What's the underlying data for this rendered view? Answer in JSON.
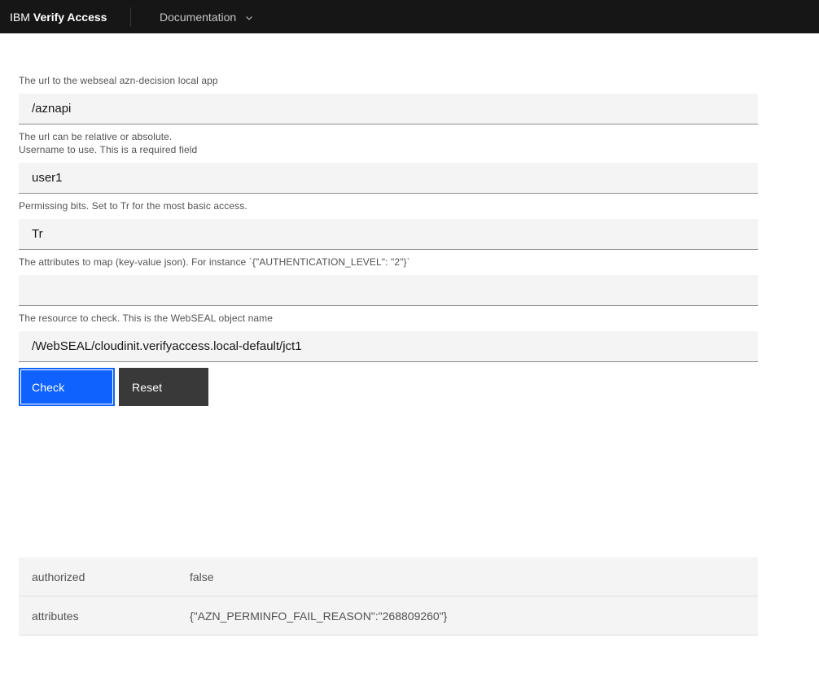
{
  "header": {
    "brand_prefix": "IBM",
    "brand_name": "Verify Access",
    "menu": {
      "documentation_label": "Documentation"
    }
  },
  "form": {
    "fields": [
      {
        "label": "The url to the webseal azn-decision local app",
        "value": "/aznapi",
        "helper": "The url can be relative or absolute."
      },
      {
        "label": "Username to use. This is a required field",
        "value": "user1"
      },
      {
        "label": "Permissing bits. Set to Tr for the most basic access.",
        "value": "Tr"
      },
      {
        "label": "The attributes to map (key-value json). For instance `{\"AUTHENTICATION_LEVEL\": \"2\"}`",
        "value": ""
      },
      {
        "label": "The resource to check. This is the WebSEAL object name",
        "value": "/WebSEAL/cloudinit.verifyaccess.local-default/jct1"
      }
    ],
    "buttons": {
      "check_label": "Check",
      "reset_label": "Reset"
    }
  },
  "results": {
    "rows": [
      {
        "key": "authorized",
        "value": "false"
      },
      {
        "key": "attributes",
        "value": "{\"AZN_PERMINFO_FAIL_REASON\":\"268809260\"}"
      }
    ]
  },
  "colors": {
    "header_bg": "#161616",
    "header_menu_text": "#c6c6c6",
    "primary_button": "#0f62fe",
    "secondary_button": "#393939",
    "input_bg": "#f4f4f4",
    "input_border_bottom": "#8d8d8d",
    "label_text": "#525252",
    "input_text": "#161616",
    "row_bg": "#f4f4f4",
    "row_border": "#e0e0e0"
  }
}
